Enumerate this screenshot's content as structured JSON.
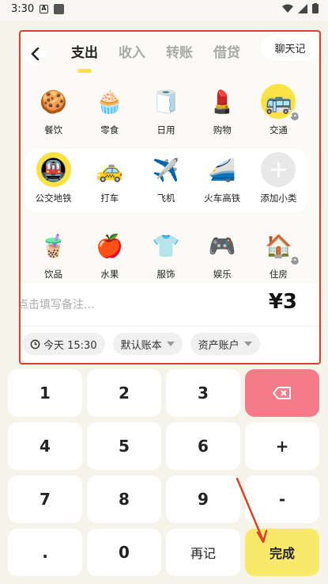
{
  "status_bar": {
    "time": "3:30",
    "a_badge": "A"
  },
  "header": {
    "tabs": [
      {
        "label": "支出",
        "active": true
      },
      {
        "label": "收入",
        "active": false
      },
      {
        "label": "转账",
        "active": false
      },
      {
        "label": "借贷",
        "active": false
      }
    ],
    "chat_button": "聊天记"
  },
  "categories": {
    "row1": [
      {
        "label": "餐饮",
        "icon": "cookie-icon",
        "glyph": "🍪"
      },
      {
        "label": "零食",
        "icon": "cupcake-icon",
        "glyph": "🧁"
      },
      {
        "label": "日用",
        "icon": "toilet-paper-icon",
        "glyph": "🧻"
      },
      {
        "label": "购物",
        "icon": "lipstick-icon",
        "glyph": "💄"
      },
      {
        "label": "交通",
        "icon": "bus-icon",
        "glyph": "🚌",
        "selected": true,
        "more": true
      }
    ],
    "row2": [
      {
        "label": "公交地铁",
        "icon": "metro-icon",
        "glyph": "🚇",
        "selected": true
      },
      {
        "label": "打车",
        "icon": "taxi-icon",
        "glyph": "🚕"
      },
      {
        "label": "飞机",
        "icon": "airplane-icon",
        "glyph": "✈️"
      },
      {
        "label": "火车高铁",
        "icon": "bullet-train-icon",
        "glyph": "🚄"
      },
      {
        "label": "添加小类",
        "icon": "plus-icon",
        "glyph": "+"
      }
    ],
    "row3": [
      {
        "label": "饮品",
        "icon": "bubble-tea-icon",
        "glyph": "🧋"
      },
      {
        "label": "水果",
        "icon": "apple-icon",
        "glyph": "🍎"
      },
      {
        "label": "服饰",
        "icon": "shirt-icon",
        "glyph": "👕"
      },
      {
        "label": "娱乐",
        "icon": "gamepad-icon",
        "glyph": "🎮"
      },
      {
        "label": "住房",
        "icon": "house-icon",
        "glyph": "🏠",
        "more": true
      }
    ]
  },
  "entry": {
    "note_placeholder": "点击填写备注...",
    "amount": "¥3"
  },
  "chips": {
    "date": "今天 15:30",
    "book": "默认账本",
    "account": "资产账户"
  },
  "keypad": {
    "k1": "1",
    "k2": "2",
    "k3": "3",
    "k4": "4",
    "k5": "5",
    "k6": "6",
    "plus": "+",
    "k7": "7",
    "k8": "8",
    "k9": "9",
    "minus": "-",
    "dot": ".",
    "k0": "0",
    "again": "再记",
    "done": "完成"
  },
  "colors": {
    "accent": "#f9e244",
    "delete": "#f47c88",
    "highlight_frame": "#d8452c"
  }
}
